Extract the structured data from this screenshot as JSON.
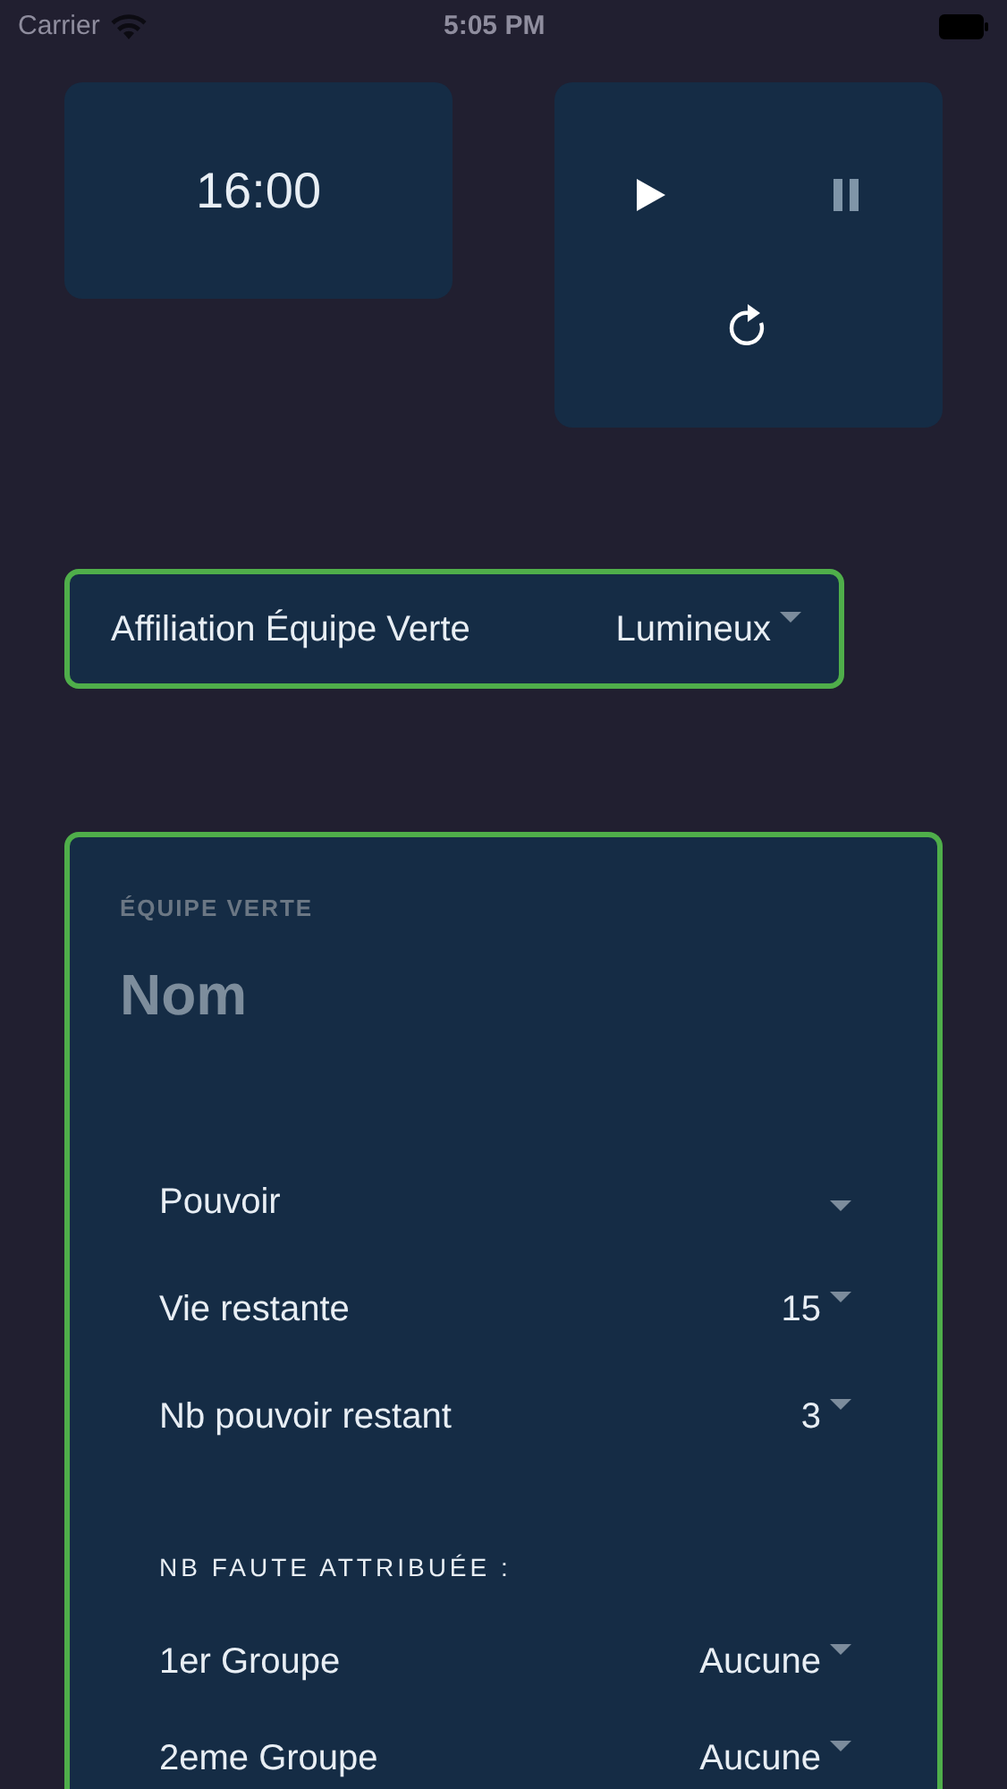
{
  "status_bar": {
    "carrier": "Carrier",
    "time": "5:05 PM"
  },
  "timer": {
    "value": "16:00"
  },
  "controls": [
    {
      "kind": "play",
      "disabled": false
    },
    {
      "kind": "pause",
      "disabled": true
    },
    {
      "kind": "reset",
      "disabled": false
    }
  ],
  "affiliation": {
    "label": "Affiliation Équipe Verte",
    "value": "Lumineux"
  },
  "team": {
    "section": "ÉQUIPE VERTE",
    "name_placeholder": "Nom",
    "rows": [
      {
        "label": "Pouvoir"
      },
      {
        "label": "Vie restante",
        "value": "15"
      },
      {
        "label": "Nb pouvoir restant",
        "value": "3"
      }
    ],
    "faults_header": "NB FAUTE ATTRIBUÉE :",
    "faults": [
      {
        "label": "1er Groupe",
        "value": "Aucune"
      },
      {
        "label": "2eme Groupe",
        "value": "Aucune"
      }
    ]
  }
}
